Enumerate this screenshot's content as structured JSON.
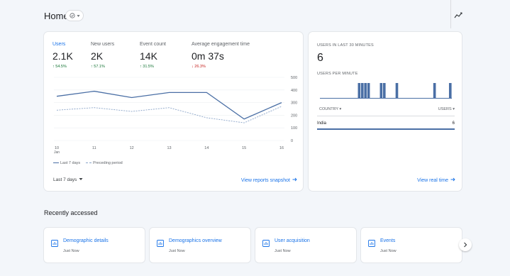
{
  "header": {
    "title": "Home",
    "status_icon": "check-circle-icon",
    "dropdown_icon": "chevron-down-icon",
    "insights_icon": "insights-icon"
  },
  "metrics": [
    {
      "label": "Users",
      "value": "2.1K",
      "delta": "54.5%",
      "direction": "up",
      "active": true
    },
    {
      "label": "New users",
      "value": "2K",
      "delta": "57.1%",
      "direction": "up",
      "active": false
    },
    {
      "label": "Event count",
      "value": "14K",
      "delta": "31.5%",
      "direction": "up",
      "active": false
    },
    {
      "label": "Average engagement time",
      "value": "0m 37s",
      "delta": "26.3%",
      "direction": "down",
      "active": false
    }
  ],
  "chart_data": {
    "type": "line",
    "x": [
      "10",
      "11",
      "12",
      "13",
      "14",
      "15",
      "16"
    ],
    "x_sublabel": "Jan",
    "yticks": [
      "500",
      "400",
      "300",
      "200",
      "100",
      "0"
    ],
    "ylim": [
      0,
      500
    ],
    "series": [
      {
        "name": "Last 7 days",
        "values": [
          350,
          390,
          340,
          380,
          380,
          170,
          300
        ],
        "style": "solid"
      },
      {
        "name": "Preceding period",
        "values": [
          240,
          260,
          230,
          260,
          180,
          140,
          270
        ],
        "style": "dashed"
      }
    ],
    "grid": true,
    "legend_position": "bottom-left"
  },
  "main_card": {
    "legend_current": "Last 7 days",
    "legend_previous": "Preceding period",
    "date_range": "Last 7 days",
    "link": "View reports snapshot"
  },
  "realtime": {
    "title": "USERS IN LAST 30 MINUTES",
    "value": "6",
    "per_minute_label": "USERS PER MINUTE",
    "bars": [
      0,
      0,
      0,
      0,
      0,
      0,
      0,
      0,
      0,
      0,
      0,
      0,
      1,
      1,
      1,
      1,
      0,
      0,
      0,
      1,
      1,
      0,
      0,
      0,
      1,
      0,
      0,
      0,
      0,
      0,
      0,
      0,
      0,
      0,
      0,
      0,
      1,
      0,
      0,
      0,
      0,
      1
    ],
    "col_country": "COUNTRY",
    "col_users": "USERS",
    "rows": [
      {
        "country": "India",
        "users": "6"
      }
    ],
    "link": "View real time"
  },
  "recent": {
    "title": "Recently accessed",
    "items": [
      {
        "name": "Demographic details",
        "sub": "Just Now"
      },
      {
        "name": "Demographics overview",
        "sub": "Just Now"
      },
      {
        "name": "User acquisition",
        "sub": "Just Now"
      },
      {
        "name": "Events",
        "sub": "Just Now"
      }
    ]
  },
  "colors": {
    "accent": "#1a73e8",
    "series_primary": "#4a6fa5",
    "series_secondary": "#8aa4c8",
    "up": "#137333",
    "down": "#c5221f"
  }
}
